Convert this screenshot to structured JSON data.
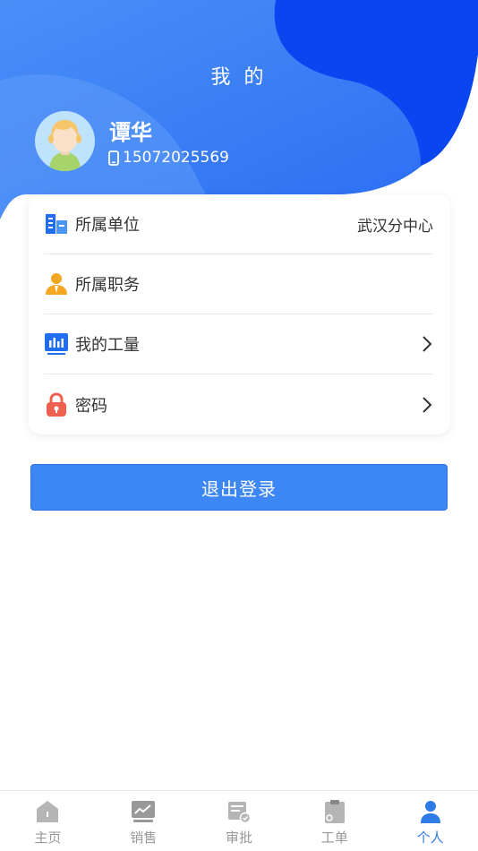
{
  "header": {
    "title": "我 的"
  },
  "user": {
    "name": "谭华",
    "phone": "15072025569"
  },
  "info_list": {
    "items": [
      {
        "label": "所属单位",
        "value": "武汉分中心",
        "icon": "building-icon",
        "has_arrow": false
      },
      {
        "label": "所属职务",
        "value": "",
        "icon": "person-badge-icon",
        "has_arrow": false
      },
      {
        "label": "我的工量",
        "value": "",
        "icon": "bar-chart-icon",
        "has_arrow": true
      },
      {
        "label": "密码",
        "value": "",
        "icon": "lock-icon",
        "has_arrow": true
      }
    ]
  },
  "logout": {
    "label": "退出登录"
  },
  "tabbar": {
    "tabs": [
      {
        "label": "主页",
        "icon": "home-icon",
        "active": false
      },
      {
        "label": "销售",
        "icon": "sales-chart-icon",
        "active": false
      },
      {
        "label": "审批",
        "icon": "approval-icon",
        "active": false
      },
      {
        "label": "工单",
        "icon": "clipboard-icon",
        "active": false
      },
      {
        "label": "个人",
        "icon": "user-icon",
        "active": true
      }
    ]
  },
  "colors": {
    "primary": "#3d87f5",
    "header_dark": "#0a46f0",
    "header_light": "#3f8af7",
    "active_tab": "#2e7de6",
    "inactive_tab": "#999999"
  }
}
